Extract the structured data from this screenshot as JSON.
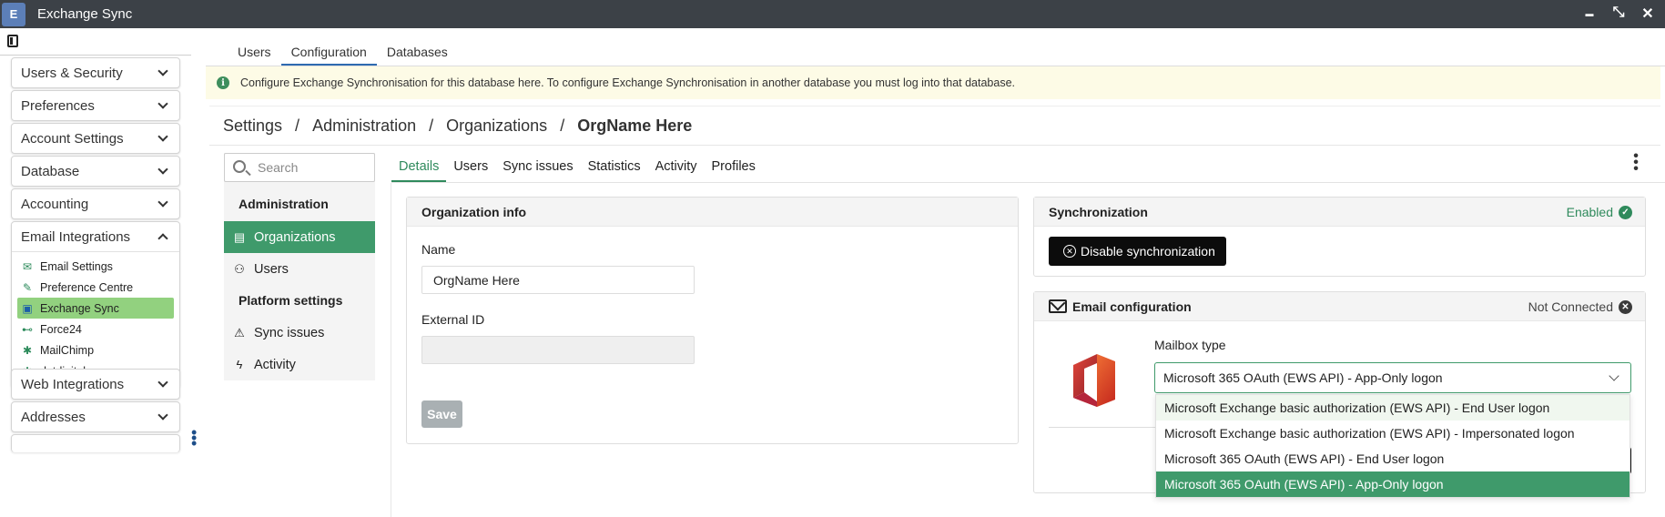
{
  "window": {
    "title": "Exchange Sync",
    "logo_text": "E",
    "controls": {
      "minimize": "▬",
      "restore": "⤡",
      "close": "✕"
    }
  },
  "sidebar": {
    "groups": [
      {
        "label": "Users & Security"
      },
      {
        "label": "Preferences"
      },
      {
        "label": "Account Settings"
      },
      {
        "label": "Database"
      },
      {
        "label": "Accounting"
      },
      {
        "label": "Email Integrations"
      },
      {
        "label": "Web Integrations"
      },
      {
        "label": "Addresses"
      }
    ],
    "email_items": [
      {
        "label": "Email Settings",
        "icon": "envelope-open-icon"
      },
      {
        "label": "Preference Centre",
        "icon": "edit-icon"
      },
      {
        "label": "Exchange Sync",
        "icon": "exchange-icon"
      },
      {
        "label": "Force24",
        "icon": "force24-icon"
      },
      {
        "label": "MailChimp",
        "icon": "puzzle-icon"
      },
      {
        "label": "dotdigital",
        "icon": "puzzle-icon"
      }
    ]
  },
  "top_tabs": [
    "Users",
    "Configuration",
    "Databases"
  ],
  "banner": {
    "text": "Configure Exchange Synchronisation for this database here. To configure Exchange Synchronisation in another database you must log into that database."
  },
  "breadcrumb": [
    "Settings",
    "Administration",
    "Organizations",
    "OrgName Here"
  ],
  "left_nav": {
    "search_placeholder": "Search",
    "section_admin": "Administration",
    "item_orgs": "Organizations",
    "item_users": "Users",
    "section_platform": "Platform settings",
    "item_sync": "Sync issues",
    "item_activity": "Activity"
  },
  "detail_tabs": [
    "Details",
    "Users",
    "Sync issues",
    "Statistics",
    "Activity",
    "Profiles"
  ],
  "org_info": {
    "title": "Organization info",
    "name_label": "Name",
    "name_value": "OrgName Here",
    "external_id_label": "External ID",
    "external_id_value": "",
    "save_label": "Save"
  },
  "sync": {
    "title": "Synchronization",
    "status": "Enabled",
    "disable_label": "Disable synchronization"
  },
  "email_config": {
    "title": "Email configuration",
    "status": "Not Connected",
    "mailbox_label": "Mailbox type",
    "selected": "Microsoft 365 OAuth (EWS API) - App-Only logon",
    "options": [
      "Microsoft Exchange basic authorization (EWS API) - End User logon",
      "Microsoft Exchange basic authorization (EWS API) - Impersonated logon",
      "Microsoft 365 OAuth (EWS API) - End User logon",
      "Microsoft 365 OAuth (EWS API) - App-Only logon"
    ]
  },
  "colors": {
    "accent_green": "#3f9a6b",
    "active_sidebar": "#92d17f",
    "titlebar": "#3c4147",
    "banner_bg": "#fdfbe6",
    "tab_blue": "#2e6ab0"
  }
}
